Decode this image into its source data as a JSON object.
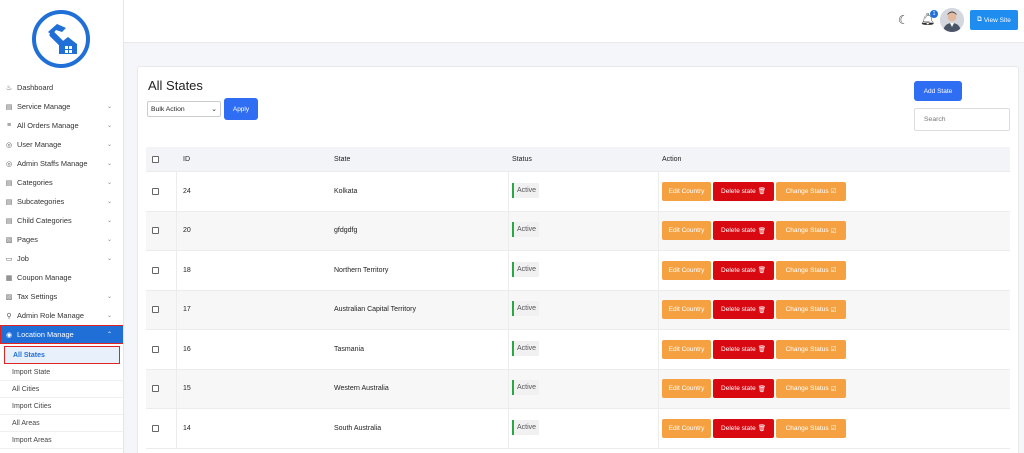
{
  "sidebar": {
    "menu": [
      {
        "label": "Dashboard",
        "icon": "dashboard-icon",
        "glyph": "♨",
        "chevron": ""
      },
      {
        "label": "Service Manage",
        "icon": "service-icon",
        "glyph": "▤",
        "chevron": "⌄"
      },
      {
        "label": "All Orders Manage",
        "icon": "orders-icon",
        "glyph": "≡",
        "chevron": "⌄"
      },
      {
        "label": "User Manage",
        "icon": "user-icon",
        "glyph": "◎",
        "chevron": "⌄"
      },
      {
        "label": "Admin Staffs Manage",
        "icon": "staff-icon",
        "glyph": "◎",
        "chevron": "⌄"
      },
      {
        "label": "Categories",
        "icon": "categories-icon",
        "glyph": "▤",
        "chevron": "⌄"
      },
      {
        "label": "Subcategories",
        "icon": "subcategories-icon",
        "glyph": "▤",
        "chevron": "⌄"
      },
      {
        "label": "Child Categories",
        "icon": "child-categories-icon",
        "glyph": "▤",
        "chevron": "⌄"
      },
      {
        "label": "Pages",
        "icon": "pages-icon",
        "glyph": "▧",
        "chevron": "⌄"
      },
      {
        "label": "Job",
        "icon": "job-icon",
        "glyph": "▭",
        "chevron": "⌄"
      },
      {
        "label": "Coupon Manage",
        "icon": "coupon-icon",
        "glyph": "▦",
        "chevron": ""
      },
      {
        "label": "Tax Settings",
        "icon": "tax-icon",
        "glyph": "▨",
        "chevron": "⌄"
      },
      {
        "label": "Admin Role Manage",
        "icon": "role-icon",
        "glyph": "⚲",
        "chevron": "⌄"
      },
      {
        "label": "Location Manage",
        "icon": "location-icon",
        "glyph": "◉",
        "chevron": "⌃"
      }
    ],
    "submenu": [
      "All States",
      "Import State",
      "All Cities",
      "Import Cities",
      "All Areas",
      "Import Areas"
    ]
  },
  "topbar": {
    "notification_count": "1",
    "view_site_label": "View Site"
  },
  "main": {
    "title": "All States",
    "bulk_action": "Bulk Action",
    "apply_label": "Apply",
    "add_state_label": "Add State",
    "search_placeholder": "Search",
    "columns": [
      "ID",
      "State",
      "Status",
      "Action"
    ],
    "rows": [
      {
        "id": "24",
        "state": "Kolkata",
        "status": "Active"
      },
      {
        "id": "20",
        "state": "gfdgdfg",
        "status": "Active"
      },
      {
        "id": "18",
        "state": "Northern Territory",
        "status": "Active"
      },
      {
        "id": "17",
        "state": "Australian Capital Territory",
        "status": "Active"
      },
      {
        "id": "16",
        "state": "Tasmania",
        "status": "Active"
      },
      {
        "id": "15",
        "state": "Western Australia",
        "status": "Active"
      },
      {
        "id": "14",
        "state": "South Australia",
        "status": "Active"
      }
    ],
    "actions": {
      "edit": "Edit Country",
      "delete": "Delete state",
      "change": "Change Status"
    }
  },
  "colors": {
    "primary": "#1f6fd6",
    "button_blue": "#2f6df2",
    "edit_orange": "#f5a142",
    "delete_red": "#d90912",
    "active_green": "#28a745"
  }
}
